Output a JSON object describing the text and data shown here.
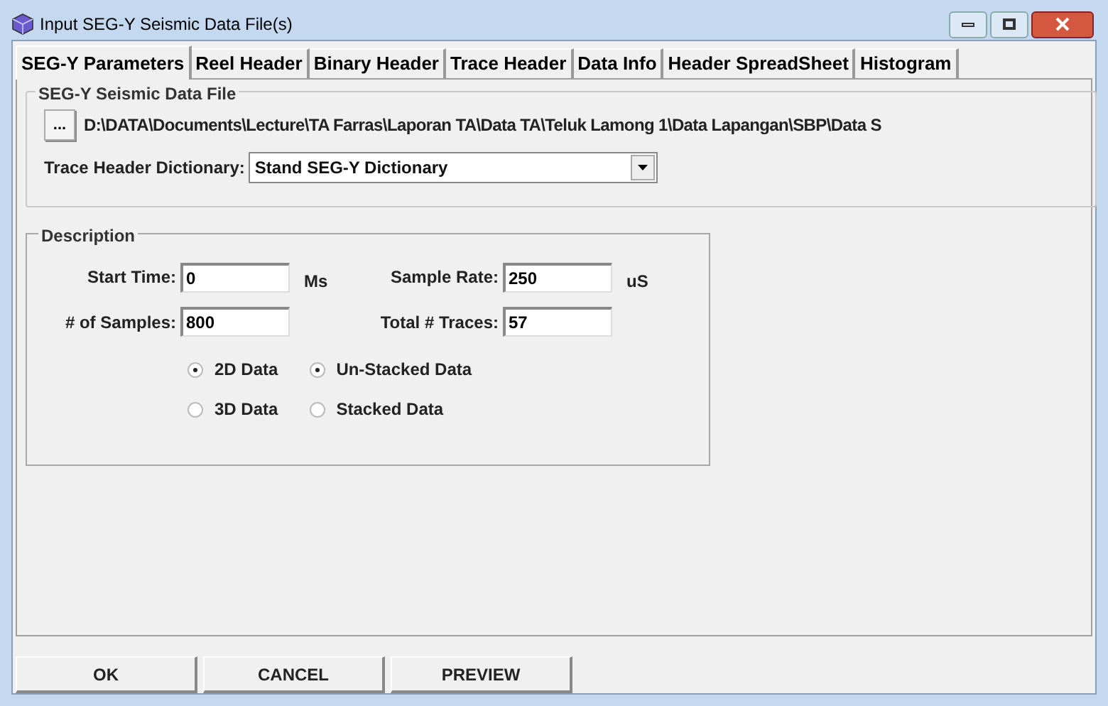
{
  "window": {
    "title": "Input SEG-Y Seismic Data File(s)"
  },
  "tabs": [
    {
      "label": "SEG-Y Parameters",
      "selected": true
    },
    {
      "label": "Reel Header",
      "selected": false
    },
    {
      "label": "Binary Header",
      "selected": false
    },
    {
      "label": "Trace Header",
      "selected": false
    },
    {
      "label": "Data Info",
      "selected": false
    },
    {
      "label": "Header SpreadSheet",
      "selected": false
    },
    {
      "label": "Histogram",
      "selected": false
    }
  ],
  "file_group": {
    "title": "SEG-Y Seismic Data File",
    "browse_button": "...",
    "path": "D:\\DATA\\Documents\\Lecture\\TA Farras\\Laporan TA\\Data TA\\Teluk Lamong 1\\Data Lapangan\\SBP\\Data S",
    "dictionary_label": "Trace Header Dictionary:",
    "dictionary_value": "Stand SEG-Y Dictionary"
  },
  "description": {
    "title": "Description",
    "fields": [
      {
        "label": "Start Time:",
        "value": "0",
        "unit": "Ms"
      },
      {
        "label": "Sample Rate:",
        "value": "250",
        "unit": "uS"
      },
      {
        "label": "# of Samples:",
        "value": "800"
      },
      {
        "label": "Total # Traces:",
        "value": "57"
      }
    ],
    "radio_groups": [
      {
        "options": [
          {
            "label": "2D Data",
            "selected": true
          },
          {
            "label": "3D Data",
            "selected": false
          }
        ]
      },
      {
        "options": [
          {
            "label": "Un-Stacked Data",
            "selected": true
          },
          {
            "label": "Stacked Data",
            "selected": false
          }
        ]
      }
    ]
  },
  "buttons": [
    "OK",
    "CANCEL",
    "PREVIEW"
  ]
}
